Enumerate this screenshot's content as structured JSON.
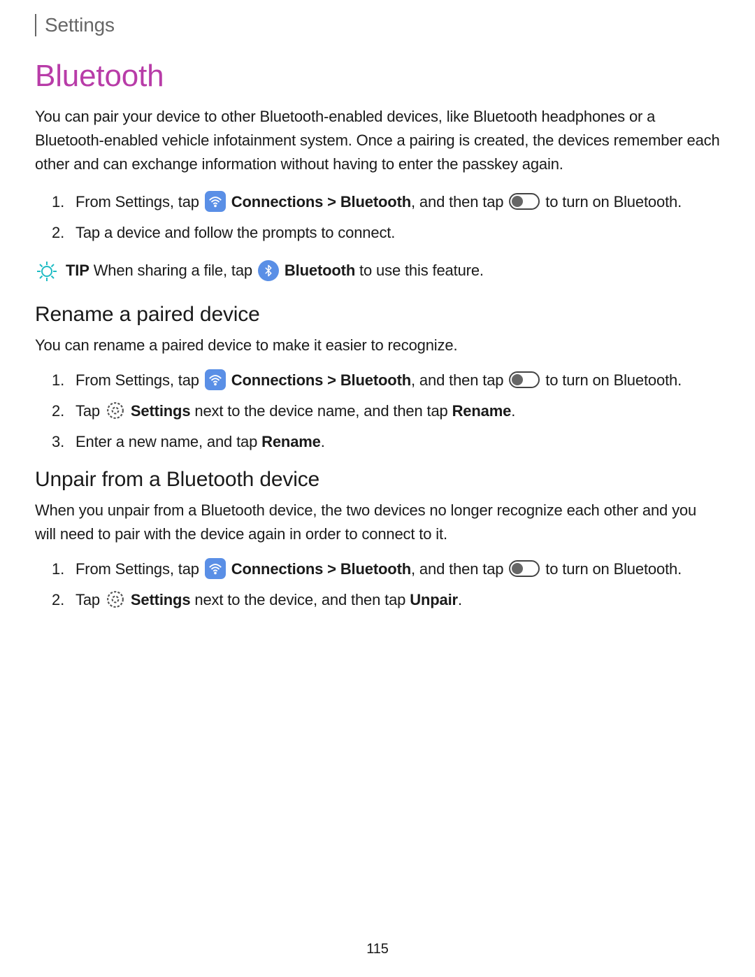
{
  "header": {
    "section": "Settings"
  },
  "title": "Bluetooth",
  "intro": "You can pair your device to other Bluetooth-enabled devices, like Bluetooth headphones or a Bluetooth-enabled vehicle infotainment system. Once a pairing is created, the devices remember each other and can exchange information without having to enter the passkey again.",
  "steps1": {
    "s1a": "From Settings, tap ",
    "s1b_bold": "Connections > Bluetooth",
    "s1c": ", and then tap ",
    "s1d": " to turn on Bluetooth.",
    "s2": "Tap a device and follow the prompts to connect."
  },
  "tip": {
    "label": "TIP",
    "a": " When sharing a file, tap ",
    "b_bold": "Bluetooth",
    "c": " to use this feature."
  },
  "rename": {
    "heading": "Rename a paired device",
    "intro": "You can rename a paired device to make it easier to recognize.",
    "s1a": "From Settings, tap ",
    "s1b_bold": "Connections > Bluetooth",
    "s1c": ", and then tap ",
    "s1d": " to turn on Bluetooth.",
    "s2a": "Tap ",
    "s2b_bold": "Settings",
    "s2c": " next to the device name, and then tap ",
    "s2d_bold": "Rename",
    "s2e": ".",
    "s3a": "Enter a new name, and tap ",
    "s3b_bold": "Rename",
    "s3c": "."
  },
  "unpair": {
    "heading": "Unpair from a Bluetooth device",
    "intro": "When you unpair from a Bluetooth device, the two devices no longer recognize each other and you will need to pair with the device again in order to connect to it.",
    "s1a": "From Settings, tap ",
    "s1b_bold": "Connections > Bluetooth",
    "s1c": ", and then tap ",
    "s1d": " to turn on Bluetooth.",
    "s2a": "Tap ",
    "s2b_bold": "Settings",
    "s2c": " next to the device, and then tap ",
    "s2d_bold": "Unpair",
    "s2e": "."
  },
  "page": "115"
}
